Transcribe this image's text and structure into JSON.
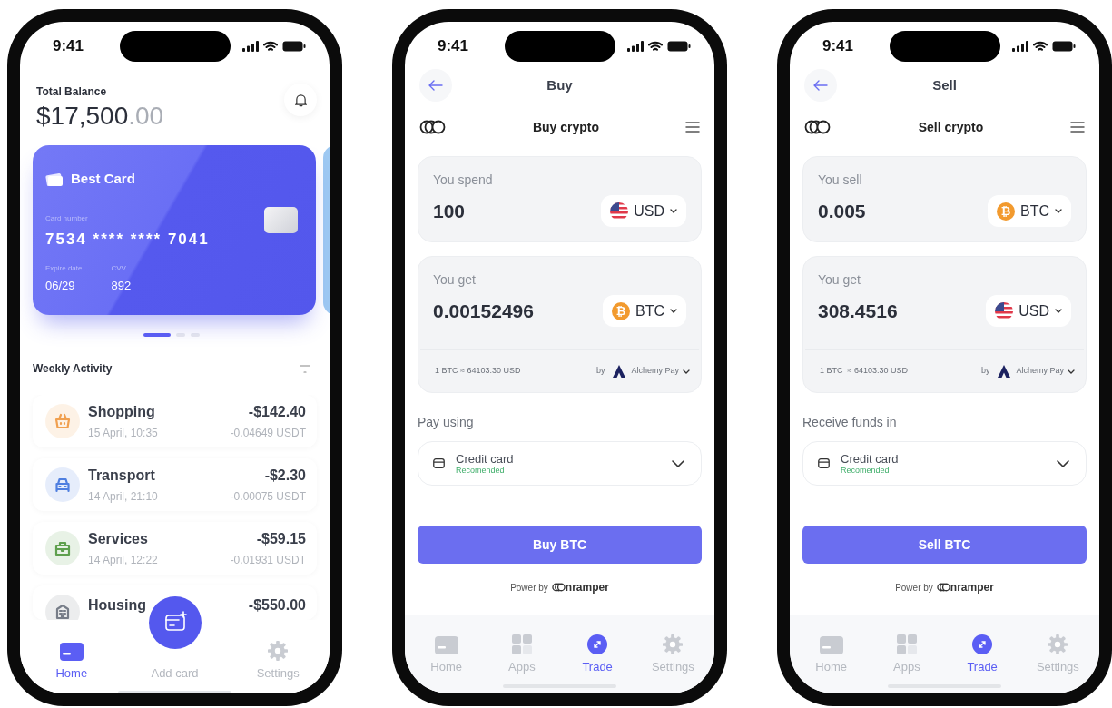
{
  "phones": [
    {
      "kind": "home",
      "status_time": "9:41",
      "balance_label": "Total Balance",
      "balance": "$17,500",
      "balance_cents": ".00",
      "card": {
        "name": "Best Card",
        "number_label": "Card number",
        "number": "7534 **** **** 7041",
        "expiry_label": "Expire date",
        "expiry": "06/29",
        "cvv_label": "CVV",
        "cvv": "892"
      },
      "pager": [
        {
          "selected": true
        },
        {
          "selected": false
        },
        {
          "selected": false
        }
      ],
      "section_title": "Weekly Activity",
      "transactions": [
        {
          "kind": "shopping",
          "color": "#f0a050",
          "title": "Shopping",
          "date": "15 April, 10:35",
          "amount": "-$142.40",
          "crypto": "-0.04649 USDT"
        },
        {
          "kind": "transport",
          "color": "#4f7fe0",
          "title": "Transport",
          "date": "14 April, 21:10",
          "amount": "-$2.30",
          "crypto": "-0.00075 USDT"
        },
        {
          "kind": "services",
          "color": "#5fa04e",
          "title": "Services",
          "date": "14 April, 12:22",
          "amount": "-$59.15",
          "crypto": "-0.01931 USDT"
        },
        {
          "kind": "housing",
          "color": "#777d88",
          "title": "Housing",
          "amount": "-$550.00"
        }
      ],
      "nav": [
        {
          "kind": "home",
          "label": "Home",
          "selected": true
        },
        {
          "kind": "add",
          "label": "Add card",
          "selected": false
        },
        {
          "kind": "settings",
          "label": "Settings",
          "selected": false
        }
      ]
    },
    {
      "kind": "trade",
      "status_time": "9:41",
      "title": "Buy",
      "widget_title": "Buy crypto",
      "from": {
        "label": "You spend",
        "amount": "100",
        "currency": {
          "code": "USD",
          "kind": "usd"
        }
      },
      "to": {
        "label": "You get",
        "amount": "0.00152496",
        "currency": {
          "code": "BTC",
          "kind": "btc",
          "symbol": "₿"
        }
      },
      "rate": "1 BTC ≈ 64103.30 USD",
      "provider_prefix": "by",
      "provider": "Alchemy Pay",
      "method_label": "Pay using",
      "method": {
        "name": "Credit card",
        "note": "Recomended"
      },
      "action": "Buy BTC",
      "powered_by": "Power by",
      "brand": "nramper",
      "nav": [
        {
          "kind": "home",
          "label": "Home",
          "selected": false
        },
        {
          "kind": "apps",
          "label": "Apps",
          "selected": false
        },
        {
          "kind": "trade",
          "label": "Trade",
          "selected": true
        },
        {
          "kind": "settings",
          "label": "Settings",
          "selected": false
        }
      ]
    },
    {
      "kind": "trade",
      "status_time": "9:41",
      "title": "Sell",
      "widget_title": "Sell crypto",
      "from": {
        "label": "You sell",
        "amount": "0.005",
        "currency": {
          "code": "BTC",
          "kind": "btc",
          "symbol": "₿"
        }
      },
      "to": {
        "label": "You get",
        "amount": "308.4516",
        "currency": {
          "code": "USD",
          "kind": "usd"
        }
      },
      "rate": "1 BTC  ≈ 64103.30 USD",
      "provider_prefix": "by",
      "provider": "Alchemy Pay",
      "method_label": "Receive funds in",
      "method": {
        "name": "Credit card",
        "note": "Recomended"
      },
      "action": "Sell BTC",
      "powered_by": "Power by",
      "brand": "nramper",
      "nav": [
        {
          "kind": "home",
          "label": "Home",
          "selected": false
        },
        {
          "kind": "apps",
          "label": "Apps",
          "selected": false
        },
        {
          "kind": "trade",
          "label": "Trade",
          "selected": true
        },
        {
          "kind": "settings",
          "label": "Settings",
          "selected": false
        }
      ]
    }
  ]
}
